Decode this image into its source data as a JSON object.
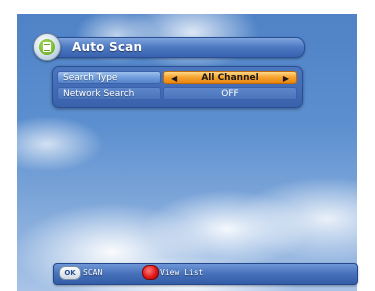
{
  "header": {
    "title": "Auto Scan",
    "icon": "scan-document-icon"
  },
  "menu": {
    "rows": [
      {
        "label": "Search Type",
        "value": "All Channel",
        "selected": true
      },
      {
        "label": "Network Search",
        "value": "OFF",
        "selected": false
      }
    ],
    "arrow_left": "◀",
    "arrow_right": "▶"
  },
  "footer": {
    "ok_key_label": "OK",
    "ok_action": "SCAN",
    "red_key_action": "View List"
  },
  "colors": {
    "highlight": "#f7a533",
    "panel_blue": "#3a62ac",
    "red_key": "#e11a1a"
  }
}
